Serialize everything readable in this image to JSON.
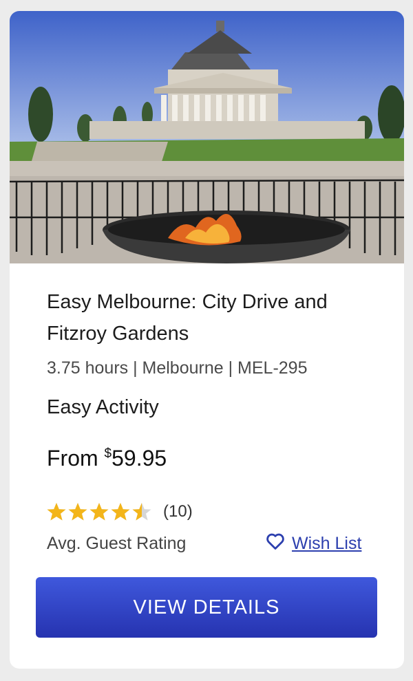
{
  "tour": {
    "title": "Easy Melbourne: City Drive and Fitzroy Gardens",
    "meta": "3.75 hours | Melbourne | MEL-295",
    "activity_level": "Easy Activity",
    "price_prefix": "From",
    "currency_symbol": "$",
    "price": "59.95"
  },
  "rating": {
    "value_stars": 4.5,
    "max_stars": 5,
    "count": "(10)",
    "label": "Avg. Guest Rating",
    "star_color": "#f3b51a"
  },
  "wishlist": {
    "label": "Wish List",
    "icon": "heart-outline-icon"
  },
  "cta": {
    "label": "VIEW DETAILS",
    "color": "#2f40c2"
  }
}
